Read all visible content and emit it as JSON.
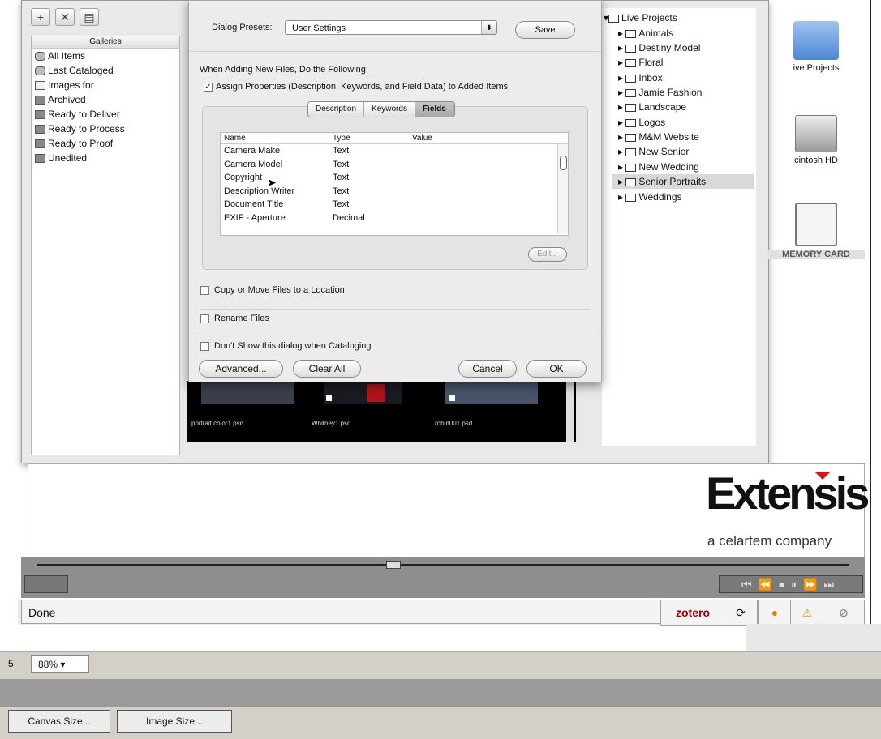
{
  "toolbar": {
    "add_icon": "plus-icon",
    "remove_icon": "x-icon",
    "sidebar_icon": "panel-icon"
  },
  "galleries": {
    "header": "Galleries",
    "items": [
      {
        "label": "All Items",
        "icon": "camera-icon"
      },
      {
        "label": "Last Cataloged",
        "icon": "camera-icon"
      },
      {
        "label": "Images for",
        "icon": "monitor-icon"
      },
      {
        "label": "Archived",
        "icon": "box-icon"
      },
      {
        "label": "Ready to Deliver",
        "icon": "box-icon"
      },
      {
        "label": "Ready to Process",
        "icon": "box-icon"
      },
      {
        "label": "Ready to Proof",
        "icon": "box-icon"
      },
      {
        "label": "Unedited",
        "icon": "box-icon"
      }
    ]
  },
  "thumbnails": [
    {
      "caption": "portrait color1.psd"
    },
    {
      "caption": "Whitney1.psd"
    },
    {
      "caption": "robin001.psd"
    }
  ],
  "dialog": {
    "presets_label": "Dialog Presets:",
    "presets_value": "User Settings",
    "save_label": "Save",
    "adding_heading": "When Adding New Files, Do the Following:",
    "assign_label": "Assign Properties (Description, Keywords, and Field Data) to Added Items",
    "assign_checked": true,
    "tabs": [
      {
        "label": "Description",
        "active": false
      },
      {
        "label": "Keywords",
        "active": false
      },
      {
        "label": "Fields",
        "active": true
      }
    ],
    "columns": {
      "name": "Name",
      "type": "Type",
      "value": "Value"
    },
    "fields": [
      {
        "name": "Camera Make",
        "type": "Text",
        "value": ""
      },
      {
        "name": "Camera Model",
        "type": "Text",
        "value": ""
      },
      {
        "name": "Copyright",
        "type": "Text",
        "value": ""
      },
      {
        "name": "Description Writer",
        "type": "Text",
        "value": ""
      },
      {
        "name": "Document Title",
        "type": "Text",
        "value": ""
      },
      {
        "name": "EXIF - Aperture",
        "type": "Decimal",
        "value": ""
      }
    ],
    "edit_label": "Edit...",
    "copy_label": "Copy or Move Files to a Location",
    "rename_label": "Rename Files",
    "dont_show_label": "Don't Show this dialog when Cataloging",
    "advanced_label": "Advanced...",
    "clear_label": "Clear All",
    "cancel_label": "Cancel",
    "ok_label": "OK"
  },
  "tree": {
    "root": "Live Projects",
    "items": [
      {
        "label": "Animals",
        "selected": false
      },
      {
        "label": "Destiny Model",
        "selected": false
      },
      {
        "label": "Floral",
        "selected": false
      },
      {
        "label": "Inbox",
        "selected": false
      },
      {
        "label": "Jamie Fashion",
        "selected": false
      },
      {
        "label": "Landscape",
        "selected": false
      },
      {
        "label": "Logos",
        "selected": false
      },
      {
        "label": "M&M Website",
        "selected": false
      },
      {
        "label": "New Senior",
        "selected": false
      },
      {
        "label": "New Wedding",
        "selected": false
      },
      {
        "label": "Senior Portraits",
        "selected": true
      },
      {
        "label": "Weddings",
        "selected": false
      }
    ]
  },
  "desktop": {
    "folder_label": "ive Projects",
    "hd_label": "cintosh HD",
    "card_label": "MEMORY CARD"
  },
  "brand": {
    "name": "Extensis",
    "tagline": "a celartem company",
    "accent": "#d9121a"
  },
  "firefox": {
    "status_text": "Done",
    "zotero_label": "zotero"
  },
  "editor": {
    "zoom_prefix": "5",
    "zoom_value": "88%",
    "canvas_size_label": "Canvas Size...",
    "image_size_label": "Image Size..."
  }
}
